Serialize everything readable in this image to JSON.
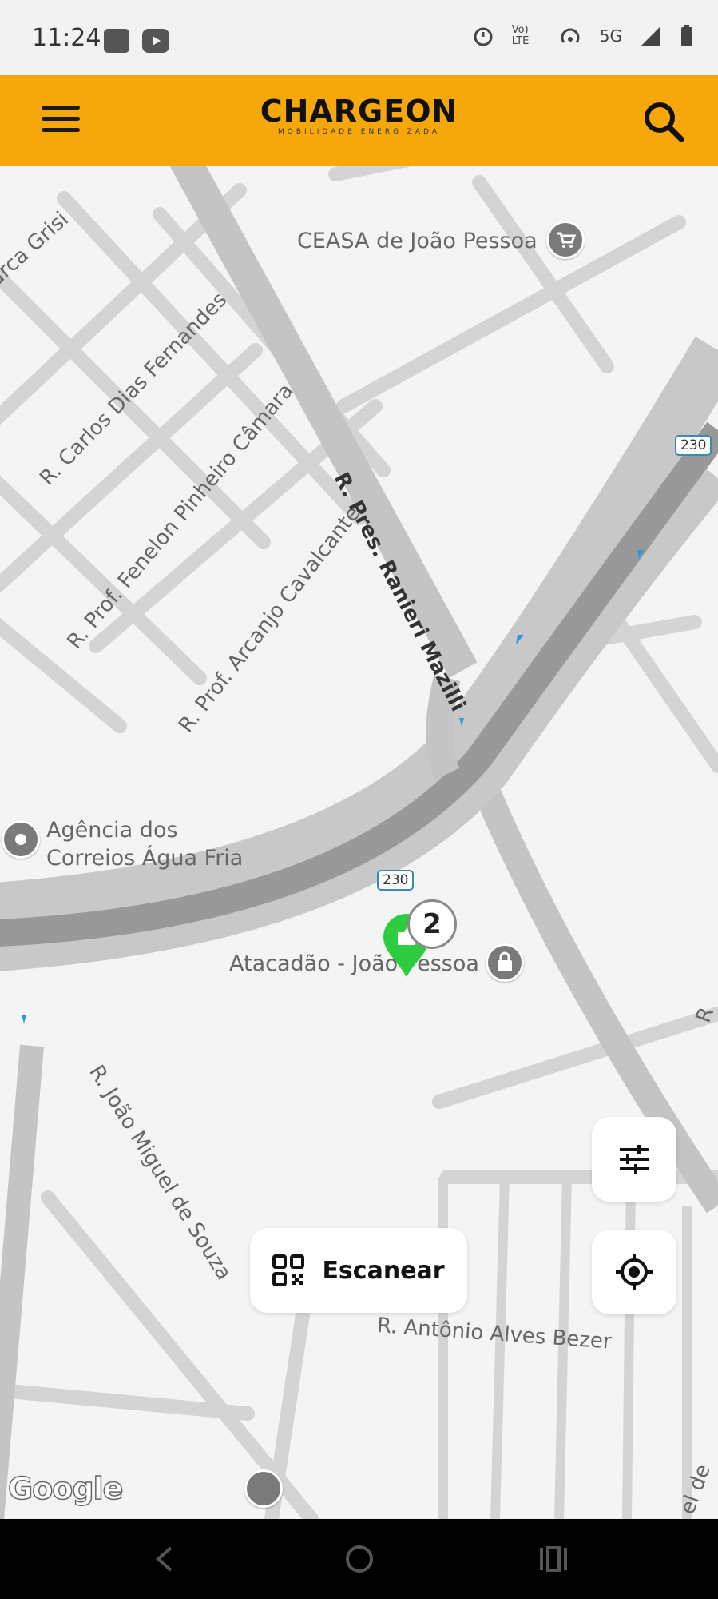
{
  "status_bar": {
    "time": "11:24",
    "network": "5G",
    "volte": "Vo) LTE",
    "icons": [
      "shop-icon",
      "youtube-icon",
      "alarm-icon",
      "volte-icon",
      "hotspot-icon",
      "signal-icon",
      "battery-icon"
    ]
  },
  "header": {
    "brand": "CHARGEON",
    "tagline": "MOBILIDADE ENERGIZADA",
    "background": "#f6a80b",
    "icons": [
      "menu-icon",
      "search-icon"
    ]
  },
  "map": {
    "streets": [
      "arca Grisi",
      "R. Carlos Dias Fernandes",
      "R. Prof. Fenelon Pinheiro Câmara",
      "R. Prof. Arcanjo Cavalcante",
      "R. Pres. Ranieri Mazilli",
      "R. João Miguel de Souza",
      "R. Antônio Alves Bezer",
      "R",
      "el de"
    ],
    "places": {
      "ceasa": "CEASA de João Pessoa",
      "correios_line1": "Agência dos",
      "correios_line2": "Correios Água Fria",
      "atacadao": "Atacadão - João Pessoa"
    },
    "route_shields": [
      "230",
      "230"
    ],
    "cluster_count": "2",
    "station_color": "#2ecc40",
    "attribution": "Google"
  },
  "controls": {
    "scan_label": "Escanear",
    "icons": [
      "qr-code-icon",
      "filter-sliders-icon",
      "locate-icon"
    ]
  },
  "nav_bar": {
    "icons": [
      "back-icon",
      "home-icon",
      "recents-icon"
    ]
  }
}
